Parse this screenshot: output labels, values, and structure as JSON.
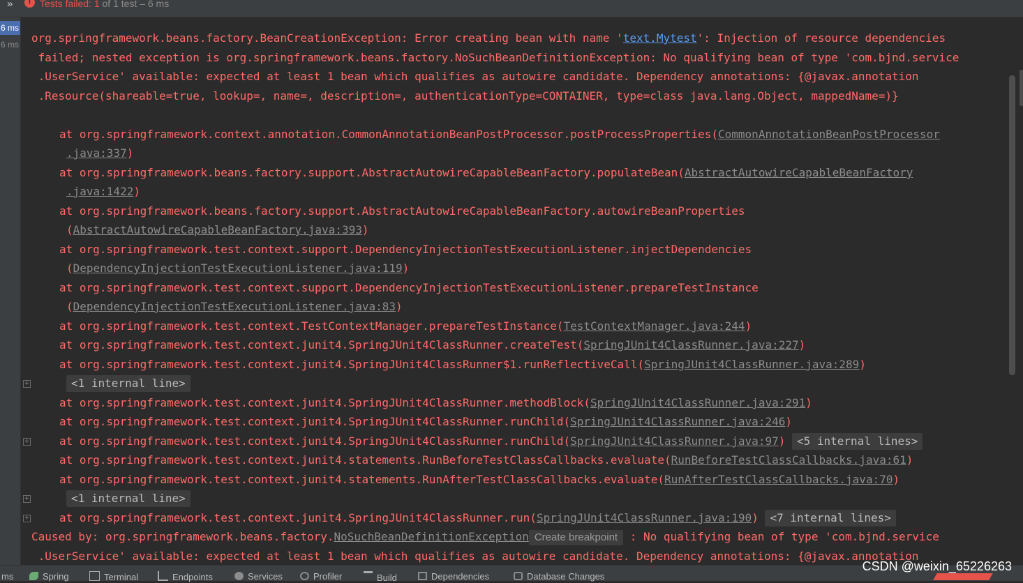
{
  "topbar": {
    "chevron": "»",
    "status_failed": "Tests failed: 1",
    "status_rest": " of 1 test – 6 ms"
  },
  "leftpanel": {
    "duration1": "6 ms",
    "duration2": "6 ms"
  },
  "console": {
    "l1a": "org.springframework.beans.factory.BeanCreationException: Error creating bean with name '",
    "l1_link": "text.Mytest",
    "l1b": "': Injection of resource dependencies",
    "l2": " failed; nested exception is org.springframework.beans.factory.NoSuchBeanDefinitionException: No qualifying bean of type 'com.bjnd.service",
    "l3": " .UserService' available: expected at least 1 bean which qualifies as autowire candidate. Dependency annotations: {@javax.annotation",
    "l4": " .Resource(shareable=true, lookup=, name=, description=, authenticationType=CONTAINER, type=class java.lang.Object, mappedName=)}",
    "s1a": "at org.springframework.context.annotation.CommonAnnotationBeanPostProcessor.postProcessProperties(",
    "s1_link": "CommonAnnotationBeanPostProcessor",
    "s1b_link": ".java:337",
    "s2a": "at org.springframework.beans.factory.support.AbstractAutowireCapableBeanFactory.populateBean(",
    "s2_link": "AbstractAutowireCapableBeanFactory",
    "s2b_link": ".java:1422",
    "s3a": "at org.springframework.beans.factory.support.AbstractAutowireCapableBeanFactory.autowireBeanProperties",
    "s3_link": "AbstractAutowireCapableBeanFactory.java:393",
    "s4a": "at org.springframework.test.context.support.DependencyInjectionTestExecutionListener.injectDependencies",
    "s4_link": "DependencyInjectionTestExecutionListener.java:119",
    "s5a": "at org.springframework.test.context.support.DependencyInjectionTestExecutionListener.prepareTestInstance",
    "s5_link": "DependencyInjectionTestExecutionListener.java:83",
    "s6a": "at org.springframework.test.context.TestContextManager.prepareTestInstance(",
    "s6_link": "TestContextManager.java:244",
    "s7a": "at org.springframework.test.context.junit4.SpringJUnit4ClassRunner.createTest(",
    "s7_link": "SpringJUnit4ClassRunner.java:227",
    "s8a": "at org.springframework.test.context.junit4.SpringJUnit4ClassRunner$1.runReflectiveCall(",
    "s8_link": "SpringJUnit4ClassRunner.java:289",
    "internal1": "<1 internal line>",
    "s9a": "at org.springframework.test.context.junit4.SpringJUnit4ClassRunner.methodBlock(",
    "s9_link": "SpringJUnit4ClassRunner.java:291",
    "s10a": "at org.springframework.test.context.junit4.SpringJUnit4ClassRunner.runChild(",
    "s10_link": "SpringJUnit4ClassRunner.java:246",
    "s11a": "at org.springframework.test.context.junit4.SpringJUnit4ClassRunner.runChild(",
    "s11_link": "SpringJUnit4ClassRunner.java:97",
    "internal5": "<5 internal lines>",
    "s12a": "at org.springframework.test.context.junit4.statements.RunBeforeTestClassCallbacks.evaluate(",
    "s12_link": "RunBeforeTestClassCallbacks.java:61",
    "s13a": "at org.springframework.test.context.junit4.statements.RunAfterTestClassCallbacks.evaluate(",
    "s13_link": "RunAfterTestClassCallbacks.java:70",
    "internal2": "<1 internal line>",
    "s14a": "at org.springframework.test.context.junit4.SpringJUnit4ClassRunner.run(",
    "s14_link": "SpringJUnit4ClassRunner.java:190",
    "internal7": "<7 internal lines>",
    "c1a": "Caused by: org.springframework.beans.factory.",
    "c1_link": "NoSuchBeanDefinitionException",
    "breakpoint": "Create breakpoint",
    "c1b": " : No qualifying bean of type 'com.bjnd.service",
    "c2": " .UserService' available: expected at least 1 bean which qualifies as autowire candidate. Dependency annotations: {@javax.annotation"
  },
  "bottombar": {
    "tabs": [
      "ms",
      "Spring",
      "Terminal",
      "Endpoints",
      "Services",
      "Profiler",
      "Build",
      "Dependencies",
      "Database Changes"
    ]
  },
  "watermark": "CSDN @weixin_65226263",
  "colors": {
    "error": "#ff6b68",
    "link_blue": "#589df6",
    "link_gray": "#8c8c8c",
    "background": "#2b2b2b"
  }
}
